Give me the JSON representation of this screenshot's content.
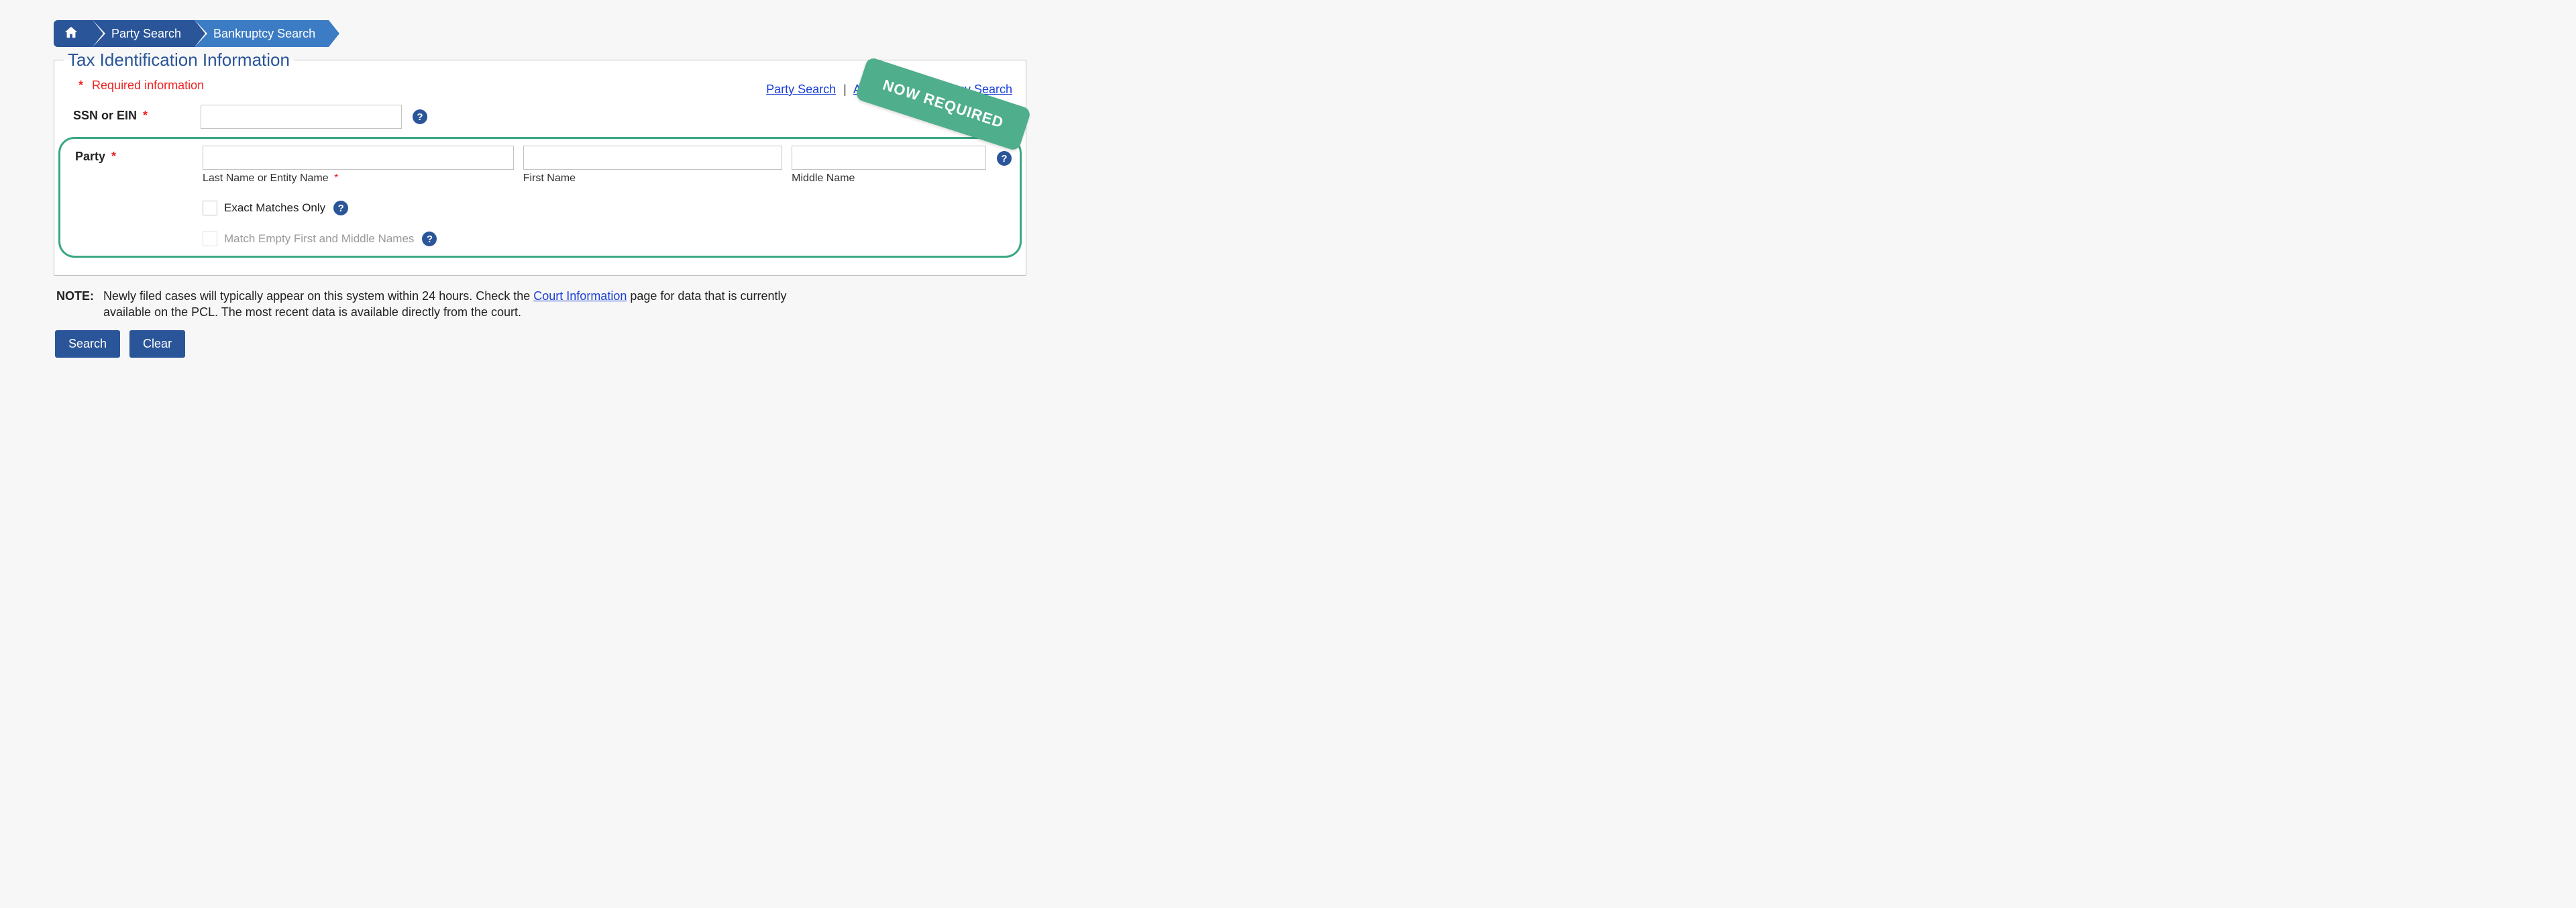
{
  "breadcrumb": {
    "home_icon": "home-icon",
    "items": [
      "Party Search",
      "Bankruptcy Search"
    ]
  },
  "legend": "Tax Identification Information",
  "required_note": "Required information",
  "top_links": {
    "party_search": "Party Search",
    "advanced": "Advanced Bankruptcy Search"
  },
  "fields": {
    "ssn": {
      "label": "SSN or EIN",
      "value": ""
    },
    "party": {
      "label": "Party",
      "last": {
        "sublabel": "Last Name or Entity Name",
        "value": ""
      },
      "first": {
        "sublabel": "First Name",
        "value": ""
      },
      "middle": {
        "sublabel": "Middle Name",
        "value": ""
      },
      "exact": "Exact Matches Only",
      "empty": "Match Empty First and Middle Names"
    }
  },
  "note": {
    "label": "NOTE:",
    "text_before": "Newly filed cases will typically appear on this system within 24 hours. Check the ",
    "link": "Court Information",
    "text_after": " page for data that is currently available on the PCL. The most recent data is available directly from the court."
  },
  "buttons": {
    "search": "Search",
    "clear": "Clear"
  },
  "ribbon": "NOW REQUIRED"
}
